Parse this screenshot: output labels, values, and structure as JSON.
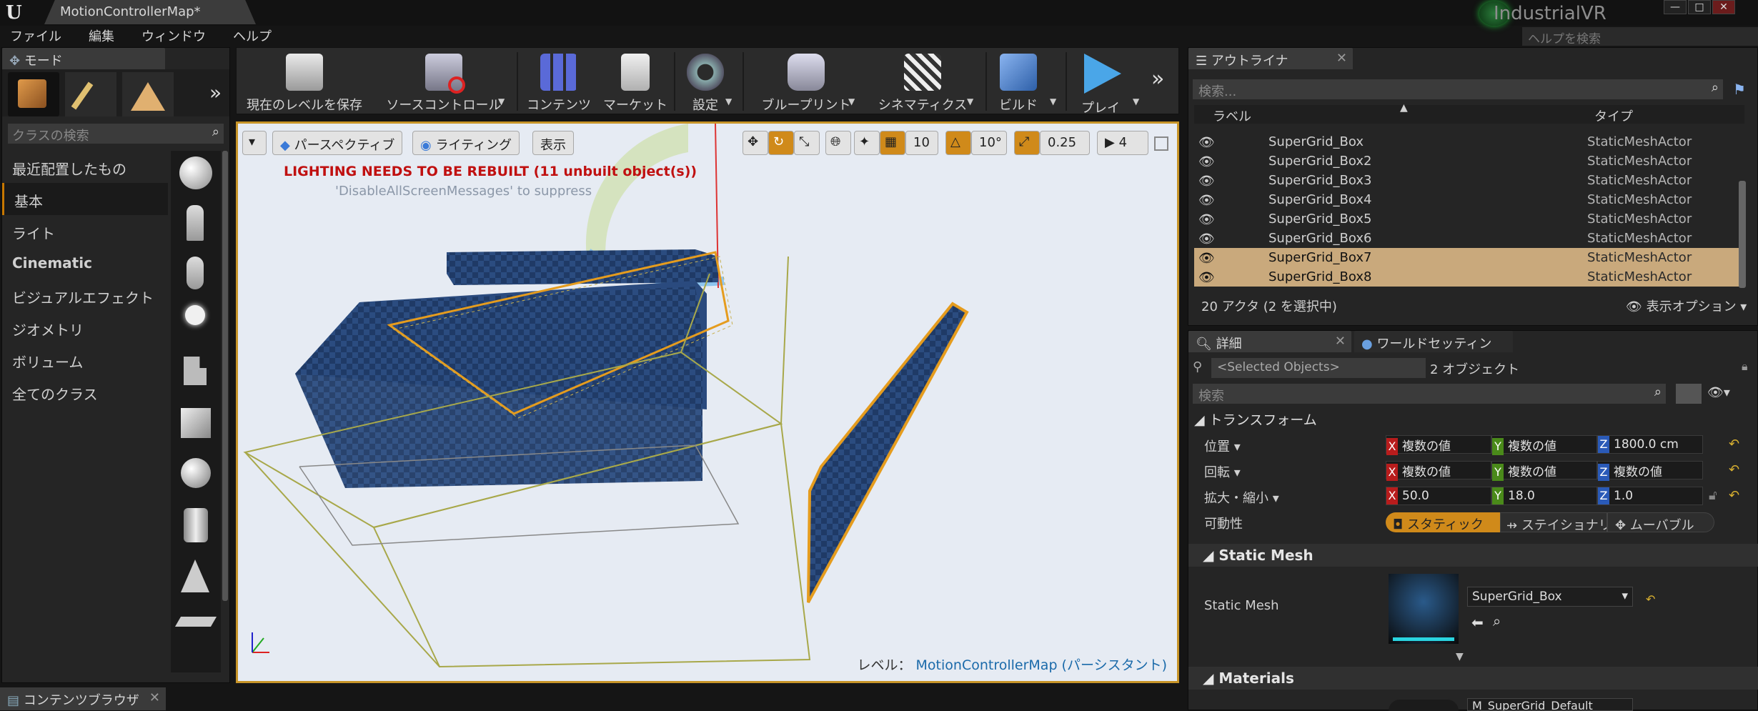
{
  "title_bar": {
    "logo": "U",
    "map_tab": "MotionControllerMap*",
    "brand": "IndustrialVR",
    "help_placeholder": "ヘルプを検索",
    "min": "—",
    "max": "□",
    "close": "✕"
  },
  "menu": [
    "ファイル",
    "編集",
    "ウィンドウ",
    "ヘルプ"
  ],
  "modes": {
    "tab": "モード",
    "search_placeholder": "クラスの検索",
    "categories": [
      "最近配置したもの",
      "基本",
      "ライト",
      "Cinematic",
      "ビジュアルエフェクト",
      "ジオメトリ",
      "ボリューム",
      "全てのクラス"
    ],
    "selected_index": 1
  },
  "toolbar": {
    "buttons": [
      "現在のレベルを保存",
      "ソースコントロール",
      "コンテンツ",
      "マーケット",
      "設定",
      "ブループリント",
      "シネマティクス",
      "ビルド",
      "プレイ"
    ],
    "more": "»"
  },
  "viewport": {
    "perspective": "パースペクティブ",
    "lighting": "ライティング",
    "show": "表示",
    "grid_snap": "10",
    "rot_snap": "10°",
    "scale_snap": "0.25",
    "cam_speed": "4",
    "warning": "LIGHTING NEEDS TO BE REBUILT (11 unbuilt object(s))",
    "warning_hint": "'DisableAllScreenMessages' to suppress",
    "level_label": "レベル：",
    "level_name": "MotionControllerMap (パーシスタント)"
  },
  "outliner": {
    "tab": "アウトライナ",
    "search_placeholder": "検索...",
    "col_label": "ラベル",
    "col_type": "タイプ",
    "rows": [
      {
        "label": "SuperGrid_Box",
        "type": "StaticMeshActor",
        "selected": false
      },
      {
        "label": "SuperGrid_Box2",
        "type": "StaticMeshActor",
        "selected": false
      },
      {
        "label": "SuperGrid_Box3",
        "type": "StaticMeshActor",
        "selected": false
      },
      {
        "label": "SuperGrid_Box4",
        "type": "StaticMeshActor",
        "selected": false
      },
      {
        "label": "SuperGrid_Box5",
        "type": "StaticMeshActor",
        "selected": false
      },
      {
        "label": "SuperGrid_Box6",
        "type": "StaticMeshActor",
        "selected": false
      },
      {
        "label": "SuperGrid_Box7",
        "type": "StaticMeshActor",
        "selected": true
      },
      {
        "label": "SuperGrid_Box8",
        "type": "StaticMeshActor",
        "selected": true
      }
    ],
    "count_text": "20 アクタ (2 を選択中)",
    "view_options": "表示オプション"
  },
  "details": {
    "tab": "詳細",
    "tab2": "ワールドセッティン",
    "selected_objects": "<Selected Objects>",
    "object_count": "2 オブジェクト",
    "search_placeholder": "検索",
    "transform_header": "トランスフォーム",
    "location_label": "位置",
    "rotation_label": "回転",
    "scale_label": "拡大・縮小",
    "mobility_label": "可動性",
    "location": [
      "複数の値",
      "複数の値",
      "1800.0 cm"
    ],
    "rotation": [
      "複数の値",
      "複数の値",
      "複数の値"
    ],
    "scale": [
      "50.0",
      "18.0",
      "1.0"
    ],
    "mobility": [
      "スタティック",
      "ステイショナリ",
      "ムーバブル"
    ],
    "static_mesh_header": "Static Mesh",
    "static_mesh_label": "Static Mesh",
    "static_mesh_value": "SuperGrid_Box",
    "materials_header": "Materials",
    "material_value": "M_SuperGrid_Default"
  },
  "content_browser": {
    "tab": "コンテンツブラウザ"
  }
}
